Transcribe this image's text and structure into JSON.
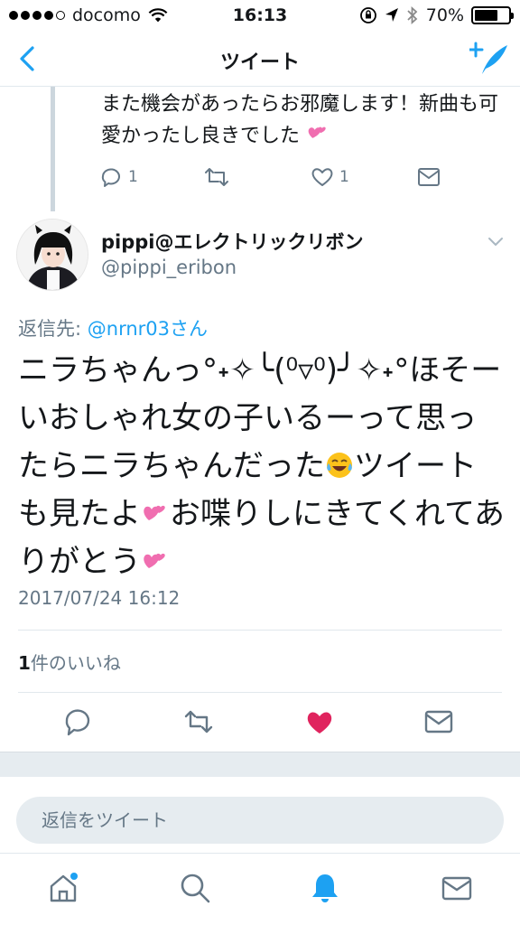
{
  "status": {
    "carrier": "docomo",
    "time": "16:13",
    "battery": "70%",
    "battery_level": 0.7
  },
  "nav": {
    "title": "ツイート",
    "back_icon": "chevron-left-icon",
    "compose_icon": "compose-tweet-icon"
  },
  "parent_tweet": {
    "text": "また機会があったらお邪魔します！新曲も可愛かったし良きでした",
    "reply_count": "1",
    "like_count": "1"
  },
  "tweet": {
    "display_name": "pippi@エレクトリックリボン",
    "username": "@pippi_eribon",
    "reply_prefix": "返信先: ",
    "reply_mention": "@nrnr03さん",
    "text_1": "ニラちゃんっ°˖✧╰(⁰▿⁰)╯✧˖°ほそーいおしゃれ女の子いるーって思ったらニラちゃんだった",
    "text_2": "ツイートも見たよ",
    "text_3": "お喋りしにきてくれてありがとう",
    "timestamp": "2017/07/24 16:12",
    "like_count": "1",
    "like_label": "件のいいね"
  },
  "reply_box": {
    "placeholder": "返信をツイート"
  },
  "colors": {
    "accent": "#1da1f2",
    "muted": "#657786",
    "like_red": "#e0245e",
    "divider": "#e1e8ed"
  }
}
